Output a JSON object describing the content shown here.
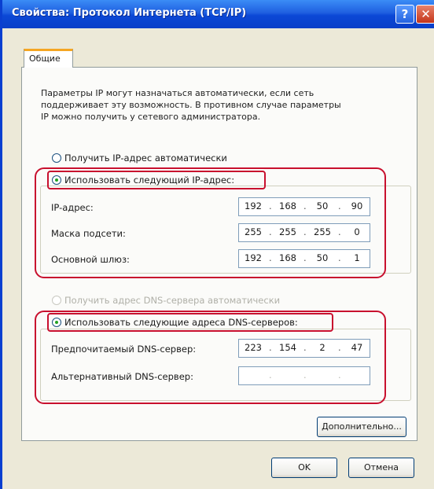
{
  "window": {
    "title": "Свойства: Протокол Интернета (TCP/IP)"
  },
  "titlebar_buttons": {
    "help": "?",
    "close": "✕"
  },
  "tabs": [
    {
      "label": "Общие"
    }
  ],
  "description": [
    "Параметры IP могут назначаться автоматически, если сеть",
    "поддерживает эту возможность. В противном случае параметры",
    "IP можно получить у сетевого администратора."
  ],
  "ip_section": {
    "auto_label": "Получить IP-адрес автоматически",
    "manual_label": "Использовать следующий IP-адрес:",
    "selected": "manual",
    "fields": [
      {
        "label": "IP-адрес:",
        "octets": [
          "192",
          "168",
          "50",
          "90"
        ]
      },
      {
        "label": "Маска подсети:",
        "octets": [
          "255",
          "255",
          "255",
          "0"
        ]
      },
      {
        "label": "Основной шлюз:",
        "octets": [
          "192",
          "168",
          "50",
          "1"
        ]
      }
    ]
  },
  "dns_section": {
    "auto_label": "Получить адрес DNS-сервера автоматически",
    "manual_label": "Использовать следующие адреса DNS-серверов:",
    "selected": "manual",
    "fields": [
      {
        "label": "Предпочитаемый DNS-сервер:",
        "octets": [
          "223",
          "154",
          "2",
          "47"
        ]
      },
      {
        "label": "Альтернативный DNS-сервер:",
        "octets": [
          "",
          "",
          "",
          ""
        ]
      }
    ]
  },
  "buttons": {
    "advanced": "Дополнительно...",
    "ok": "OK",
    "cancel": "Отмена"
  },
  "colors": {
    "titlebar": "#0a3fc8",
    "dialog_bg": "#ece9d8",
    "highlight": "#c8102e",
    "radio_dot": "#21a121"
  }
}
